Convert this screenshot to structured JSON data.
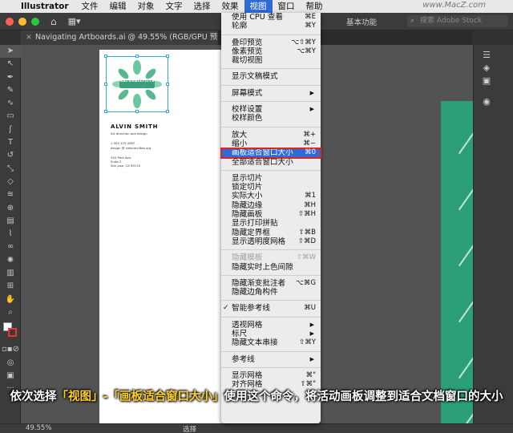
{
  "menubar": {
    "app_name": "Illustrator",
    "items": [
      "文件",
      "编辑",
      "对象",
      "文字",
      "选择",
      "效果",
      "视图",
      "窗口",
      "帮助"
    ],
    "active_index": 6,
    "watermark": "www.MacZ.com"
  },
  "appbar": {
    "workspace_label": "基本功能",
    "search_placeholder": "搜索 Adobe Stock",
    "traffic_colors": [
      "#fe5f57",
      "#febc2e",
      "#28c840"
    ]
  },
  "tab": {
    "title": "Navigating Artboards.ai @ 49.55% (RGB/GPU 预览)",
    "close": "×"
  },
  "artboard": {
    "logo_text": "NATURALLYLITE",
    "name": "ALVIN SMITH",
    "role": "Art direction and design",
    "phone": "1 555 123 4567",
    "email": "design @ naturalvlitea.org",
    "address1": "345 Park Ave.",
    "address2": "Suite 2",
    "address3": "San Jose, CA 95110",
    "accent_color": "#2c9e78",
    "leaf_color": "#6cc6a0"
  },
  "view_menu": {
    "items": [
      {
        "label": "使用 CPU 查看",
        "shortcut": "⌘E"
      },
      {
        "label": "轮廓",
        "shortcut": "⌘Y"
      },
      {
        "sep": true
      },
      {
        "label": "叠印预览",
        "shortcut": "⌥⇧⌘Y"
      },
      {
        "label": "像素预览",
        "shortcut": "⌥⌘Y"
      },
      {
        "label": "裁切视图",
        "shortcut": ""
      },
      {
        "sep": true
      },
      {
        "label": "显示文稿模式",
        "shortcut": ""
      },
      {
        "sep": true
      },
      {
        "label": "屏幕模式",
        "submenu": true
      },
      {
        "sep": true
      },
      {
        "label": "校样设置",
        "submenu": true
      },
      {
        "label": "校样颜色",
        "shortcut": ""
      },
      {
        "sep": true
      },
      {
        "label": "放大",
        "shortcut": "⌘+"
      },
      {
        "label": "缩小",
        "shortcut": "⌘−"
      },
      {
        "label": "画板适合窗口大小",
        "shortcut": "⌘0",
        "highlighted": true
      },
      {
        "label": "全部适合窗口大小",
        "shortcut": ""
      },
      {
        "sep": true
      },
      {
        "label": "显示切片",
        "shortcut": ""
      },
      {
        "label": "锁定切片",
        "shortcut": ""
      },
      {
        "label": "实际大小",
        "shortcut": "⌘1"
      },
      {
        "label": "隐藏边缘",
        "shortcut": "⌘H"
      },
      {
        "label": "隐藏画板",
        "shortcut": "⇧⌘H"
      },
      {
        "label": "显示打印拼贴",
        "shortcut": ""
      },
      {
        "label": "隐藏定界框",
        "shortcut": "⇧⌘B"
      },
      {
        "label": "显示透明度网格",
        "shortcut": "⇧⌘D"
      },
      {
        "sep": true
      },
      {
        "label": "隐藏模板",
        "shortcut": "⇧⌘W",
        "disabled": true
      },
      {
        "label": "隐藏实时上色间隙",
        "shortcut": ""
      },
      {
        "sep": true
      },
      {
        "label": "隐藏渐变批注者",
        "shortcut": "⌥⌘G"
      },
      {
        "label": "隐藏边角构件",
        "shortcut": ""
      },
      {
        "sep": true
      },
      {
        "label": "智能参考线",
        "shortcut": "⌘U",
        "checked": true
      },
      {
        "sep": true
      },
      {
        "label": "透视网格",
        "submenu": true
      },
      {
        "label": "标尺",
        "submenu": true
      },
      {
        "label": "隐藏文本串接",
        "shortcut": "⇧⌘Y"
      },
      {
        "sep": true
      },
      {
        "label": "参考线",
        "submenu": true
      },
      {
        "sep": true
      },
      {
        "label": "显示网格",
        "shortcut": "⌘\""
      },
      {
        "label": "对齐网格",
        "shortcut": "⇧⌘\""
      }
    ]
  },
  "statusbar": {
    "zoom": "49.55%",
    "selection": "选择"
  },
  "caption": {
    "part1": "依次选择",
    "hl1": "「视图」-「画板适合窗口大小」",
    "part2": "使用这个命令，将活动画板调整到适合文档窗口的大小"
  },
  "right_panel_icons": [
    "properties-icon",
    "layers-icon",
    "libraries-icon",
    "color-icon"
  ],
  "tool_icons": [
    "selection-tool-icon",
    "direct-selection-tool-icon",
    "pen-tool-icon",
    "pencil-tool-icon",
    "curvature-tool-icon",
    "rectangle-tool-icon",
    "paintbrush-tool-icon",
    "type-tool-icon",
    "rotate-tool-icon",
    "scale-tool-icon",
    "eraser-tool-icon",
    "width-tool-icon",
    "shape-builder-tool-icon",
    "gradient-tool-icon",
    "eyedropper-tool-icon",
    "blend-tool-icon",
    "symbol-sprayer-tool-icon",
    "column-graph-tool-icon",
    "artboard-tool-icon",
    "hand-tool-icon",
    "zoom-tool-icon"
  ]
}
